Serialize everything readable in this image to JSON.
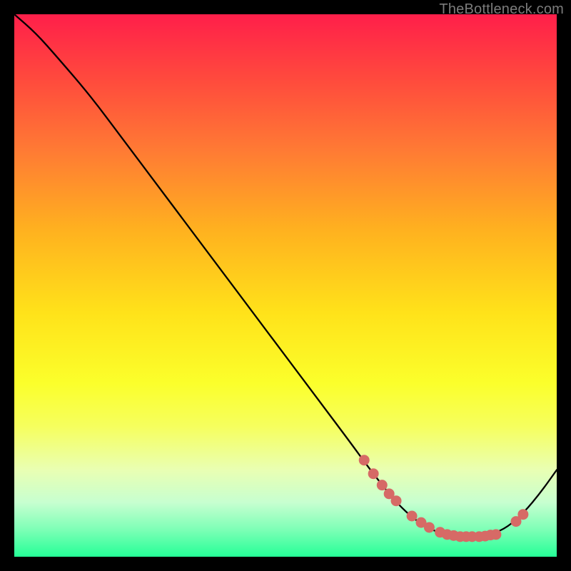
{
  "watermark": "TheBottleneck.com",
  "colors": {
    "page_bg": "#000000",
    "curve_stroke": "#000000",
    "marker_fill": "#d66a66",
    "marker_stroke": "#d66a66",
    "gradient_top": "#ff1f4a",
    "gradient_bottom": "#25ff97"
  },
  "chart_data": {
    "type": "line",
    "title": "",
    "xlabel": "",
    "ylabel": "",
    "xlim": [
      0,
      100
    ],
    "ylim": [
      0,
      100
    ],
    "legend": false,
    "grid": false,
    "notes": "No axis ticks or labels visible; x and y normalized 0–100. y=0 is bottom (green), y=100 is top (red). Curve drops from top-left to a flat minimum ~x≈72–89 then rises.",
    "series": [
      {
        "name": "bottleneck-curve",
        "x": [
          0,
          4,
          8,
          14,
          20,
          26,
          32,
          38,
          44,
          50,
          56,
          62,
          66,
          70,
          73,
          76,
          79,
          82,
          85,
          88,
          91,
          94,
          97,
          100
        ],
        "y": [
          100,
          96.5,
          92,
          85,
          77,
          69,
          61,
          53,
          45,
          37,
          29,
          21,
          15.5,
          10.5,
          7.5,
          5.4,
          4.2,
          3.7,
          3.7,
          4.1,
          5.5,
          8.2,
          11.8,
          16
        ]
      }
    ],
    "markers": {
      "name": "highlighted-points",
      "x": [
        64.5,
        66.2,
        67.8,
        69.1,
        70.4,
        73.3,
        75.0,
        76.5,
        78.5,
        79.8,
        81.0,
        82.2,
        83.3,
        84.4,
        85.7,
        86.8,
        87.8,
        88.8,
        92.5,
        93.8
      ],
      "y": [
        17.8,
        15.3,
        13.2,
        11.6,
        10.3,
        7.5,
        6.3,
        5.4,
        4.5,
        4.1,
        3.9,
        3.7,
        3.7,
        3.7,
        3.7,
        3.8,
        4.0,
        4.1,
        6.5,
        7.8
      ]
    }
  }
}
